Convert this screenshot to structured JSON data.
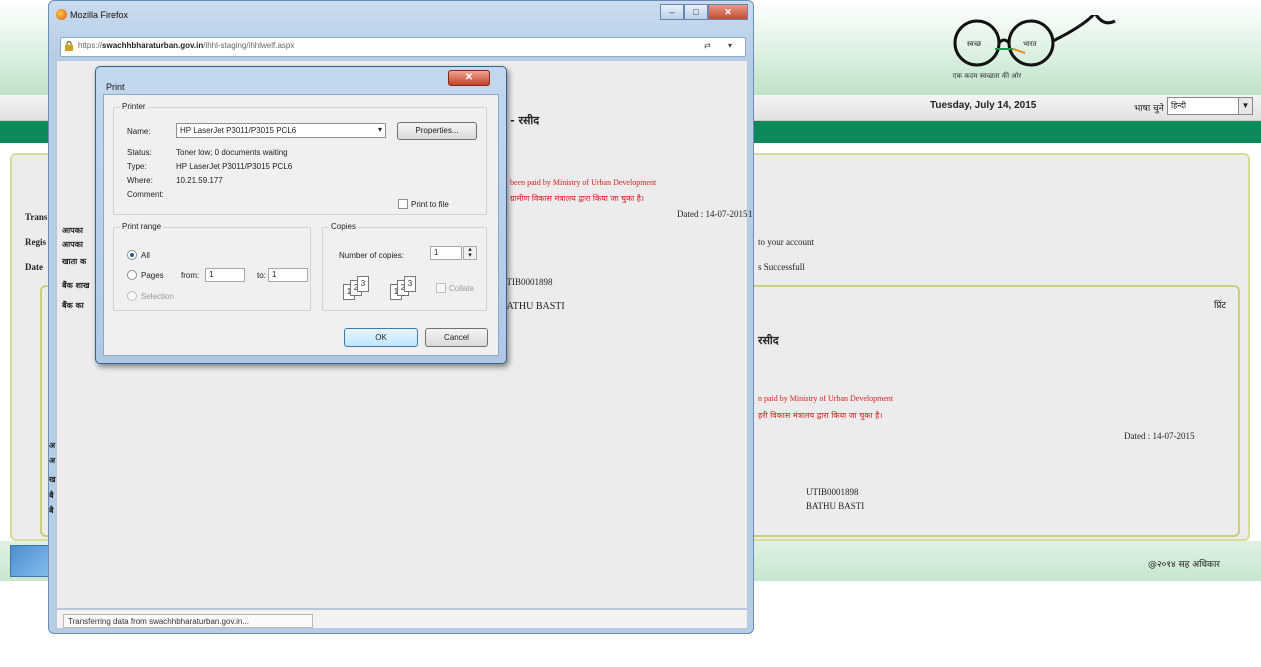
{
  "site": {
    "logo_left_text": "स्वच्छ",
    "logo_right_text": "भारत",
    "logo_tagline": "एक कदम स्वच्छता की ओर",
    "date": "Tuesday, July 14, 2015",
    "lang_label": "भाषा चुने :",
    "lang_value": "हिन्दी",
    "footer_text": "@२०१४ सह अधिकार"
  },
  "receipt": {
    "heading_suffix": "प - रसीद",
    "heading_suffix2": "रसीद",
    "red_line1": "been paid by Ministry of Urban Development",
    "red_line2": "ग्रामीण विकास मंत्रालय द्वारा किया जा चुका है।",
    "red_line1_b": "n paid by Ministry of Urban Development",
    "red_line2_b": "हरी विकास मंत्रालय द्वारा किया जा चुका है।",
    "dated": "Dated : 14-07-2015",
    "dated_marker": "1",
    "dated_b": "Dated : 14-07-2015",
    "to_account": "to your account",
    "successful": "s Successfull",
    "ifsc": "UTIB0001898",
    "branch": "BATHU BASTI",
    "ifsc_b": "UTIB0001898",
    "branch_b": "BATHU BASTI",
    "print_link": "प्रिंट",
    "left_labels": [
      "Trans",
      "Regis",
      "Date"
    ],
    "left_hindi": [
      "आपका",
      "आपका",
      "खाता क",
      "बैंक शाख",
      "बैंक का"
    ],
    "left_hindi_b": [
      "अ",
      "अ",
      "ख",
      "बै",
      "बै"
    ]
  },
  "browser": {
    "title": "Mozilla Firefox",
    "url_prefix": "https://",
    "url_host": "swachhbharaturban.gov.in",
    "url_path": "/ihhl-staging/ihhlwelf.aspx",
    "status": "Transferring data from swachhbharaturban.gov.in..."
  },
  "print_dialog": {
    "title": "Print",
    "printer_group": "Printer",
    "name_label": "Name:",
    "printer_name": "HP LaserJet P3011/P3015 PCL6",
    "properties_label": "Properties...",
    "status_label": "Status:",
    "status_value": "Toner low; 0 documents waiting",
    "type_label": "Type:",
    "type_value": "HP LaserJet P3011/P3015 PCL6",
    "where_label": "Where:",
    "where_value": "10.21.59.177",
    "comment_label": "Comment:",
    "print_to_file": "Print to file",
    "range_group": "Print range",
    "all_label": "All",
    "pages_label": "Pages",
    "from_label": "from:",
    "from_value": "1",
    "to_label": "to:",
    "to_value": "1",
    "selection_label": "Selection",
    "copies_group": "Copies",
    "num_copies_label": "Number of copies:",
    "num_copies_value": "1",
    "collate_label": "Collate",
    "ok_label": "OK",
    "cancel_label": "Cancel"
  }
}
